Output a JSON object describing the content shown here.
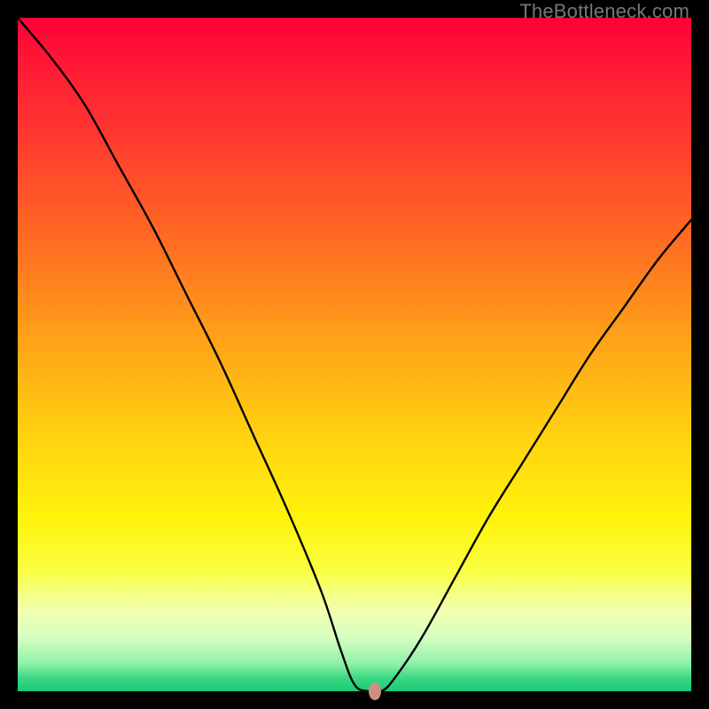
{
  "watermark": "TheBottleneck.com",
  "chart_data": {
    "type": "line",
    "title": "",
    "xlabel": "",
    "ylabel": "",
    "xlim": [
      0,
      100
    ],
    "ylim": [
      0,
      100
    ],
    "series": [
      {
        "name": "bottleneck-curve",
        "x": [
          0,
          5,
          10,
          15,
          20,
          25,
          30,
          35,
          40,
          45,
          48,
          50,
          52,
          54,
          56,
          60,
          65,
          70,
          75,
          80,
          85,
          90,
          95,
          100
        ],
        "y": [
          100,
          94,
          87,
          78,
          69,
          59,
          49,
          38,
          27,
          15,
          6,
          1,
          0,
          0,
          2,
          8,
          17,
          26,
          34,
          42,
          50,
          57,
          64,
          70
        ]
      }
    ],
    "marker": {
      "x": 53,
      "y": 0,
      "color": "#cf8f7e"
    },
    "background_gradient": {
      "orientation": "vertical",
      "stops": [
        {
          "pos": 0.0,
          "color": "#ff0038"
        },
        {
          "pos": 0.5,
          "color": "#ffb400"
        },
        {
          "pos": 0.78,
          "color": "#fff20a"
        },
        {
          "pos": 1.0,
          "color": "#19c876"
        }
      ]
    }
  }
}
